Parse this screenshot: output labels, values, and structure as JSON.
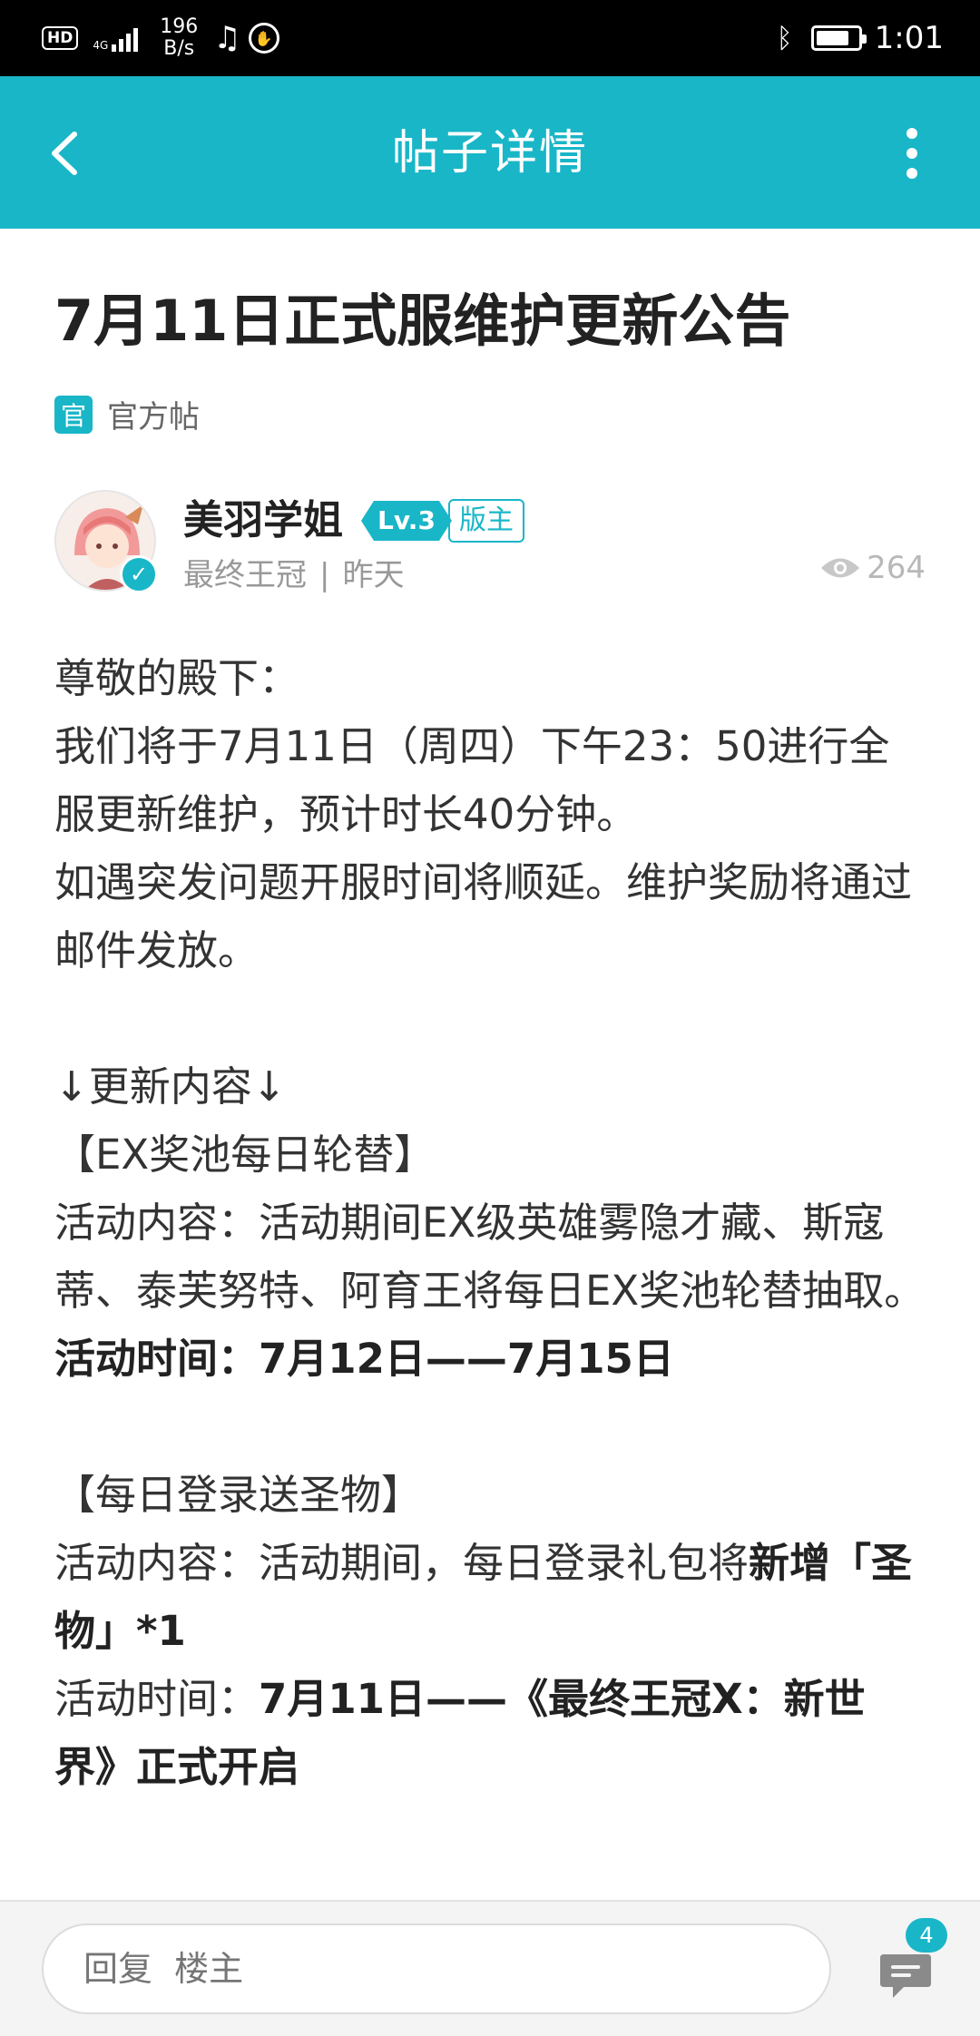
{
  "status_bar": {
    "hd": "HD",
    "network": "4G",
    "speed_value": "196",
    "speed_unit": "B/s",
    "time": "1:01",
    "battery_level": 0.8
  },
  "nav": {
    "title": "帖子详情",
    "back_icon": "chevron-left-icon",
    "more_icon": "more-vertical-icon"
  },
  "post": {
    "title": "7月11日正式服维护更新公告",
    "official_badge": "官",
    "official_label": "官方帖",
    "author": {
      "name": "美羽学姐",
      "level": "Lv.3",
      "role": "版主",
      "community": "最终王冠",
      "separator": "|",
      "time": "昨天",
      "views": "264"
    },
    "body": [
      {
        "parts": [
          {
            "t": "尊敬的殿下："
          }
        ]
      },
      {
        "parts": [
          {
            "t": "我们将于7月11日（周四）下午23：50进行全服更新维护，预计时长40分钟。"
          }
        ]
      },
      {
        "parts": [
          {
            "t": "如遇突发问题开服时间将顺延。维护奖励将通过邮件发放。"
          }
        ]
      },
      {
        "parts": []
      },
      {
        "parts": [
          {
            "t": "↓更新内容↓"
          }
        ]
      },
      {
        "parts": [
          {
            "t": "【EX奖池每日轮替】"
          }
        ]
      },
      {
        "parts": [
          {
            "t": "活动内容：活动期间EX级英雄雾隐才藏、斯寇蒂、泰芙努特、阿育王将每日EX奖池轮替抽取。"
          }
        ]
      },
      {
        "parts": [
          {
            "t": "活动时间：7月12日——7月15日",
            "b": true
          }
        ]
      },
      {
        "parts": []
      },
      {
        "parts": [
          {
            "t": "【每日登录送圣物】"
          }
        ]
      },
      {
        "parts": [
          {
            "t": "活动内容：活动期间，每日登录礼包将"
          },
          {
            "t": "新增「圣物」*1",
            "b": true
          }
        ]
      },
      {
        "parts": [
          {
            "t": "活动时间："
          },
          {
            "t": "7月11日——《最终王冠X：新世界》正式开启",
            "b": true
          }
        ]
      }
    ]
  },
  "bottom_bar": {
    "reply_placeholder": "回复  楼主",
    "comment_count": "4"
  },
  "colors": {
    "accent": "#19b6c8",
    "status_bar": "#000000"
  }
}
